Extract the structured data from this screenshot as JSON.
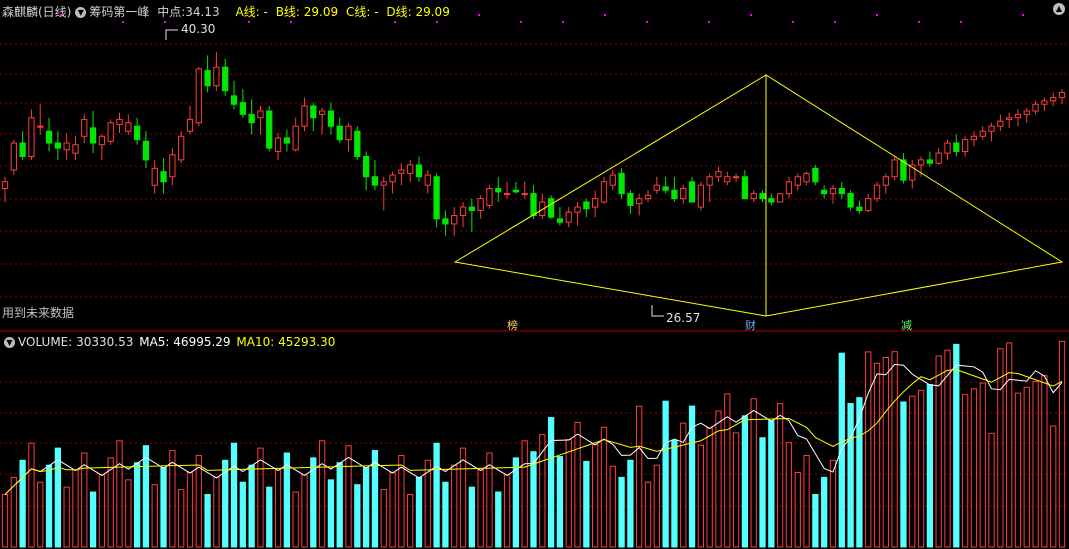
{
  "header": {
    "stock_name": "森麒麟(日线)",
    "indicator_name": "筹码第一峰",
    "midpoint_label": "中点:",
    "midpoint_value": "34.13",
    "a_line": "A线: -",
    "b_line": "B线: 29.09",
    "c_line": "C线: -",
    "d_line": "D线: 29.09"
  },
  "annotations": {
    "high_price": "40.30",
    "low_price": "26.57",
    "future_data_note": "用到未来数据",
    "markers": [
      "榜",
      "财",
      "减"
    ]
  },
  "volume_header": {
    "title": "VOLUME:",
    "value": "30330.53",
    "ma5_label": "MA5:",
    "ma5_value": "46995.29",
    "ma10_label": "MA10:",
    "ma10_value": "45293.30"
  },
  "colors": {
    "background": "#000000",
    "up": "#ff3c3c",
    "down": "#00e600",
    "volume_down": "#54ffff",
    "grid": "#8b0000",
    "pattern_line": "#ffff00",
    "ma5": "#ffffff",
    "ma10": "#ffff00",
    "magenta_dots": "#ff00ff"
  },
  "chart_data": {
    "type": "candlestick",
    "price_range": [
      24.4,
      42.2
    ],
    "volume_range": [
      0,
      105000
    ],
    "candles_ohlc": [
      [
        32.2,
        32.9,
        31.4,
        32.6
      ],
      [
        33.3,
        35.1,
        33.0,
        34.9
      ],
      [
        34.9,
        35.6,
        33.9,
        34.1
      ],
      [
        34.1,
        36.9,
        33.9,
        36.4
      ],
      [
        35.9,
        37.2,
        35.4,
        35.9
      ],
      [
        35.6,
        36.4,
        34.4,
        34.9
      ],
      [
        34.9,
        35.6,
        33.9,
        34.6
      ],
      [
        34.5,
        35.5,
        33.9,
        34.9
      ],
      [
        34.3,
        35.3,
        33.9,
        34.8
      ],
      [
        35.3,
        36.6,
        34.9,
        36.3
      ],
      [
        35.8,
        36.8,
        34.3,
        34.9
      ],
      [
        34.8,
        35.4,
        33.9,
        35.3
      ],
      [
        35.0,
        36.3,
        34.8,
        36.1
      ],
      [
        36.0,
        36.7,
        35.5,
        36.3
      ],
      [
        35.6,
        36.6,
        35.4,
        36.1
      ],
      [
        35.9,
        36.4,
        34.8,
        35.1
      ],
      [
        35.0,
        35.6,
        33.4,
        33.9
      ],
      [
        32.4,
        33.9,
        31.9,
        33.4
      ],
      [
        33.2,
        34.0,
        31.9,
        32.6
      ],
      [
        32.9,
        34.6,
        32.4,
        34.2
      ],
      [
        33.9,
        35.6,
        33.7,
        35.3
      ],
      [
        35.6,
        37.1,
        35.4,
        36.3
      ],
      [
        36.1,
        39.4,
        35.9,
        39.3
      ],
      [
        39.2,
        40.1,
        37.9,
        38.3
      ],
      [
        38.3,
        40.3,
        38.0,
        39.4
      ],
      [
        39.4,
        39.9,
        37.7,
        38.0
      ],
      [
        37.7,
        38.6,
        36.9,
        37.2
      ],
      [
        37.3,
        38.1,
        36.4,
        36.6
      ],
      [
        36.6,
        37.5,
        35.4,
        36.1
      ],
      [
        36.4,
        37.1,
        35.4,
        36.8
      ],
      [
        36.8,
        37.1,
        34.4,
        34.6
      ],
      [
        34.4,
        35.5,
        33.9,
        35.2
      ],
      [
        35.2,
        35.7,
        34.4,
        34.9
      ],
      [
        34.5,
        36.4,
        34.4,
        35.9
      ],
      [
        35.9,
        37.6,
        35.6,
        37.1
      ],
      [
        37.1,
        37.3,
        35.6,
        36.4
      ],
      [
        36.6,
        37.0,
        35.4,
        36.8
      ],
      [
        36.8,
        37.3,
        35.4,
        35.9
      ],
      [
        35.9,
        36.4,
        34.9,
        35.1
      ],
      [
        35.1,
        36.1,
        34.4,
        35.9
      ],
      [
        35.6,
        35.9,
        33.9,
        34.1
      ],
      [
        34.1,
        34.4,
        32.1,
        32.9
      ],
      [
        32.9,
        33.9,
        32.1,
        32.4
      ],
      [
        32.4,
        32.9,
        30.9,
        32.6
      ],
      [
        32.6,
        33.2,
        31.9,
        33.0
      ],
      [
        33.1,
        33.7,
        32.4,
        33.3
      ],
      [
        33.1,
        33.9,
        32.6,
        33.6
      ],
      [
        33.6,
        34.1,
        32.6,
        32.9
      ],
      [
        32.4,
        33.3,
        31.9,
        33.0
      ],
      [
        32.9,
        33.1,
        29.9,
        30.4
      ],
      [
        30.4,
        30.9,
        29.4,
        30.1
      ],
      [
        30.1,
        31.1,
        29.4,
        30.6
      ],
      [
        30.6,
        31.4,
        29.9,
        31.1
      ],
      [
        31.1,
        31.6,
        29.6,
        30.9
      ],
      [
        30.9,
        31.8,
        30.4,
        31.6
      ],
      [
        31.2,
        32.4,
        31.0,
        32.2
      ],
      [
        32.2,
        32.9,
        31.4,
        32.0
      ],
      [
        31.9,
        32.6,
        31.6,
        31.9
      ],
      [
        32.1,
        32.6,
        31.9,
        32.0
      ],
      [
        31.9,
        32.6,
        31.6,
        31.9
      ],
      [
        31.9,
        32.4,
        30.4,
        30.6
      ],
      [
        30.6,
        31.9,
        30.4,
        31.4
      ],
      [
        31.6,
        31.8,
        30.4,
        30.5
      ],
      [
        30.4,
        31.1,
        30.0,
        30.2
      ],
      [
        30.2,
        31.1,
        29.9,
        30.8
      ],
      [
        30.8,
        31.4,
        30.0,
        31.1
      ],
      [
        31.4,
        31.6,
        30.5,
        31.0
      ],
      [
        31.1,
        32.1,
        30.5,
        31.6
      ],
      [
        31.4,
        32.9,
        31.3,
        32.6
      ],
      [
        32.4,
        33.3,
        32.1,
        33.0
      ],
      [
        33.1,
        33.4,
        31.6,
        31.9
      ],
      [
        31.9,
        32.1,
        30.7,
        31.2
      ],
      [
        31.3,
        31.9,
        30.6,
        31.6
      ],
      [
        31.6,
        32.1,
        31.4,
        31.8
      ],
      [
        32.1,
        32.9,
        31.9,
        32.4
      ],
      [
        32.3,
        32.9,
        31.9,
        32.1
      ],
      [
        32.1,
        32.9,
        31.4,
        31.6
      ],
      [
        31.6,
        32.4,
        31.3,
        32.2
      ],
      [
        32.6,
        32.9,
        31.4,
        31.4
      ],
      [
        31.1,
        32.6,
        30.9,
        32.4
      ],
      [
        32.4,
        33.1,
        31.4,
        32.9
      ],
      [
        32.9,
        33.5,
        32.6,
        33.2
      ],
      [
        32.6,
        33.2,
        32.4,
        32.9
      ],
      [
        32.9,
        33.1,
        32.6,
        32.9
      ],
      [
        32.9,
        33.3,
        31.6,
        31.6
      ],
      [
        31.6,
        32.1,
        31.4,
        31.9
      ],
      [
        31.9,
        32.1,
        31.4,
        31.6
      ],
      [
        31.6,
        31.9,
        31.2,
        31.4
      ],
      [
        31.4,
        31.9,
        31.4,
        31.9
      ],
      [
        31.9,
        32.9,
        31.6,
        32.6
      ],
      [
        32.4,
        33.1,
        32.1,
        32.9
      ],
      [
        32.6,
        33.2,
        32.4,
        33.1
      ],
      [
        33.4,
        33.6,
        32.4,
        32.6
      ],
      [
        32.1,
        32.4,
        31.6,
        31.9
      ],
      [
        31.9,
        32.4,
        31.3,
        32.2
      ],
      [
        32.2,
        32.6,
        31.6,
        31.9
      ],
      [
        31.9,
        32.1,
        30.9,
        31.1
      ],
      [
        31.1,
        31.5,
        30.7,
        30.9
      ],
      [
        30.9,
        31.9,
        30.8,
        31.6
      ],
      [
        31.6,
        32.6,
        31.4,
        32.4
      ],
      [
        32.4,
        33.1,
        31.9,
        32.9
      ],
      [
        32.9,
        34.1,
        32.7,
        33.9
      ],
      [
        33.9,
        34.3,
        32.5,
        32.7
      ],
      [
        32.7,
        33.9,
        32.2,
        33.6
      ],
      [
        33.6,
        34.1,
        32.9,
        33.9
      ],
      [
        33.9,
        34.4,
        33.5,
        33.7
      ],
      [
        33.7,
        34.6,
        33.6,
        34.3
      ],
      [
        34.3,
        35.1,
        33.9,
        34.9
      ],
      [
        34.9,
        35.4,
        34.1,
        34.4
      ],
      [
        34.4,
        35.3,
        34.1,
        35.1
      ],
      [
        35.1,
        35.6,
        34.7,
        35.3
      ],
      [
        35.3,
        35.9,
        35.1,
        35.6
      ],
      [
        35.6,
        36.1,
        35.0,
        35.9
      ],
      [
        35.9,
        36.6,
        35.6,
        36.2
      ],
      [
        36.3,
        36.7,
        35.8,
        36.4
      ],
      [
        36.4,
        36.9,
        35.9,
        36.6
      ],
      [
        36.6,
        37.0,
        36.1,
        36.8
      ],
      [
        36.8,
        37.4,
        36.6,
        37.2
      ],
      [
        37.2,
        37.6,
        36.8,
        37.4
      ],
      [
        37.4,
        37.9,
        37.1,
        37.6
      ],
      [
        37.6,
        38.1,
        37.2,
        37.9
      ]
    ],
    "volume_note": "Volume bars (red = up day outline, cyan = down day), MA5 white, MA10 yellow",
    "pattern": "diamond"
  }
}
